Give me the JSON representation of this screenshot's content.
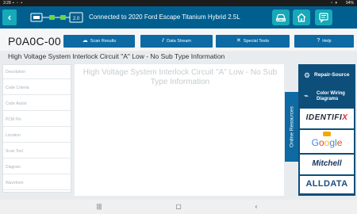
{
  "status_bar": {
    "time": "3:28",
    "battery": "94%"
  },
  "header": {
    "connection_text": "Connected to 2020 Ford Escape Titanium Hybrid 2.5L",
    "connection_icon_label": "2.0"
  },
  "code": {
    "dtc": "P0A0C-00",
    "description": "High Voltage System Interlock Circuit \"A\" Low  - No Sub Type Information"
  },
  "nav_buttons": {
    "scan_results": "Scan Results",
    "data_stream": "Data Stream",
    "special_tests": "Special Tests",
    "help": "Help"
  },
  "menu": {
    "items": [
      "Description",
      "Code Criteria",
      "Code Assist",
      "PCM Pin",
      "Location",
      "Scan Tool",
      "Diagram",
      "Waveform"
    ]
  },
  "content": {
    "title": "High Voltage System Interlock Circuit \"A\" Low  - No Sub Type Information"
  },
  "online_resources": {
    "tab_label": "Online Resources",
    "repair_source": "Repair-Source",
    "wiring_line1": "Color Wiring",
    "wiring_line2": "Diagrams",
    "identifix": "IDENTIFI",
    "identifix_x": "X",
    "google_letters": [
      "G",
      "o",
      "o",
      "g",
      "l",
      "e"
    ],
    "mitchell": "Mitchell",
    "alldata": "ALLDATA"
  },
  "icons": {
    "back": "back-arrow-icon",
    "vehicle": "vehicle-icon",
    "home": "home-icon",
    "report": "report-icon"
  },
  "colors": {
    "header": "#005f8e",
    "accent_button": "#16a9b8",
    "nav_button": "#0e6aa3",
    "resources_panel": "#0c4f7a"
  }
}
